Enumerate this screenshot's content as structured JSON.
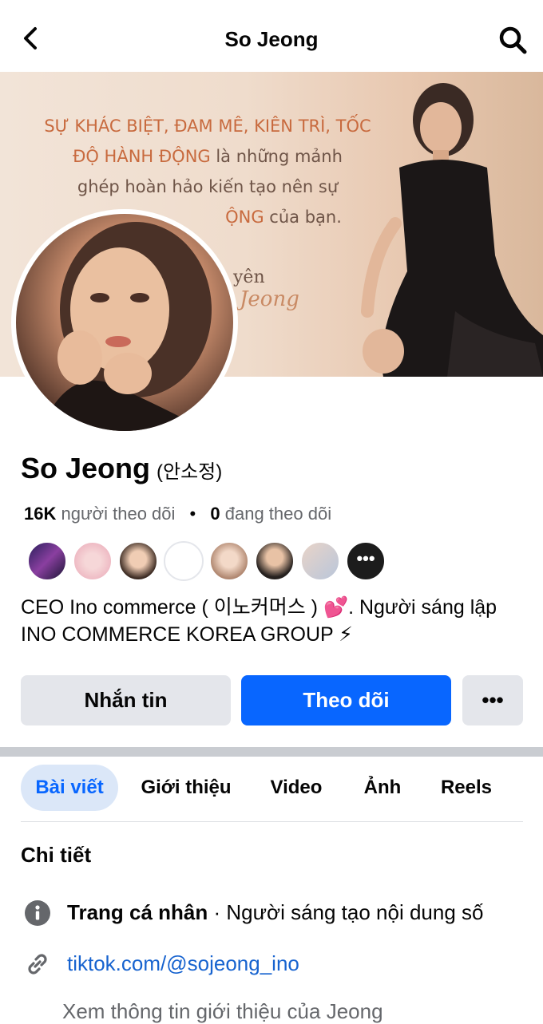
{
  "header": {
    "title": "So Jeong"
  },
  "cover": {
    "quote_line1": "SỰ KHÁC BIỆT, ĐAM MÊ, KIÊN TRÌ, TỐC",
    "quote_line2_accent": "ĐỘ HÀNH ĐỘNG",
    "quote_line2_plain": " là những mảnh",
    "quote_line3": "ghép hoàn hảo kiến tạo nên sự",
    "quote_line4_accent": "ỘNG",
    "quote_line4_plain": " của bạn.",
    "signature": "yên",
    "script": "Jeong"
  },
  "profile": {
    "name": "So Jeong",
    "name_native": "(안소정)",
    "followers_count": "16K",
    "followers_label": "người theo dõi",
    "following_count": "0",
    "following_label": "đang theo dõi",
    "more_friends": "•••",
    "bio": "CEO Ino commerce ( 이노커머스 ) 💕.  Người sáng lập INO COMMERCE KOREA GROUP ⚡"
  },
  "actions": {
    "message": "Nhắn tin",
    "follow": "Theo dõi",
    "more": "•••"
  },
  "tabs": [
    {
      "label": "Bài viết",
      "active": true
    },
    {
      "label": "Giới thiệu",
      "active": false
    },
    {
      "label": "Video",
      "active": false
    },
    {
      "label": "Ảnh",
      "active": false
    },
    {
      "label": "Reels",
      "active": false
    }
  ],
  "details": {
    "title": "Chi tiết",
    "info_bold": "Trang cá nhân",
    "info_rest": " · Người sáng tạo nội dung số",
    "link": "tiktok.com/@sojeong_ino",
    "cut_line": "Xem thông tin giới thiệu của Jeong"
  },
  "colors": {
    "accent_blue": "#0866ff",
    "button_gray": "#e4e6eb",
    "link_blue": "#1763cf"
  }
}
